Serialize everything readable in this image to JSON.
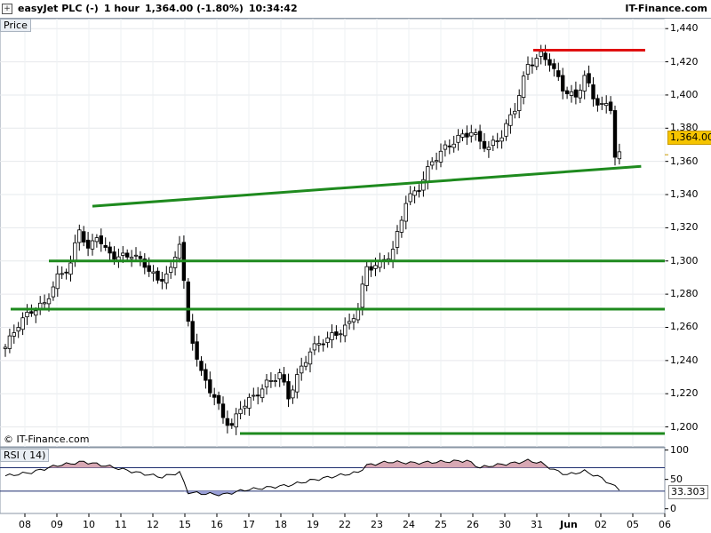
{
  "header": {
    "instrument": "easyJet PLC (-)",
    "timeframe": "1 hour",
    "last": "1,364.00 (-1.80%)",
    "time": "10:34:42",
    "brand": "IT-Finance.com"
  },
  "price_panel_label": "Price",
  "watermark": "© IT-Finance.com",
  "rsi_panel_label": "RSI ( 14)",
  "badges": {
    "price": "1,364.00",
    "rsi": "33.303"
  },
  "colors": {
    "support": "#1e8a1e",
    "resistance": "#e01010",
    "candle_up": "#ffffff",
    "candle_down": "#000000",
    "rsi_fill": "#d8a8b4",
    "price_badge": "#f5c400"
  },
  "chart_data": [
    {
      "type": "candlestick",
      "title": "easyJet PLC (-)",
      "xlabel": "",
      "ylabel": "Price",
      "ylim": [
        1188,
        1446
      ],
      "y_ticks": [
        "1,200",
        "1,220",
        "1,240",
        "1,260",
        "1,280",
        "1,300",
        "1,320",
        "1,340",
        "1,360",
        "1,380",
        "1,400",
        "1,420",
        "1,440"
      ],
      "y_tick_values": [
        1200,
        1220,
        1240,
        1260,
        1280,
        1300,
        1320,
        1340,
        1360,
        1380,
        1400,
        1420,
        1440
      ],
      "x_ticks": [
        "08",
        "09",
        "10",
        "11",
        "12",
        "15",
        "16",
        "17",
        "18",
        "19",
        "22",
        "23",
        "24",
        "25",
        "26",
        "30",
        "31",
        "Jun",
        "02",
        "05",
        "06"
      ],
      "grid": true,
      "close_path": [
        [
          0,
          1248
        ],
        [
          3,
          1262
        ],
        [
          6,
          1270
        ],
        [
          9,
          1274
        ],
        [
          12,
          1290
        ],
        [
          15,
          1298
        ],
        [
          17,
          1320
        ],
        [
          19,
          1306
        ],
        [
          21,
          1316
        ],
        [
          23,
          1306
        ],
        [
          26,
          1302
        ],
        [
          29,
          1304
        ],
        [
          32,
          1298
        ],
        [
          35,
          1288
        ],
        [
          38,
          1294
        ],
        [
          40,
          1312
        ],
        [
          42,
          1262
        ],
        [
          45,
          1232
        ],
        [
          48,
          1218
        ],
        [
          50,
          1206
        ],
        [
          52,
          1200
        ],
        [
          54,
          1212
        ],
        [
          57,
          1218
        ],
        [
          60,
          1226
        ],
        [
          63,
          1232
        ],
        [
          65,
          1218
        ],
        [
          67,
          1230
        ],
        [
          70,
          1246
        ],
        [
          73,
          1252
        ],
        [
          76,
          1256
        ],
        [
          79,
          1262
        ],
        [
          81,
          1272
        ],
        [
          83,
          1296
        ],
        [
          86,
          1298
        ],
        [
          89,
          1306
        ],
        [
          92,
          1336
        ],
        [
          95,
          1344
        ],
        [
          98,
          1360
        ],
        [
          101,
          1368
        ],
        [
          104,
          1374
        ],
        [
          107,
          1378
        ],
        [
          109,
          1372
        ],
        [
          111,
          1368
        ],
        [
          114,
          1376
        ],
        [
          117,
          1392
        ],
        [
          120,
          1418
        ],
        [
          123,
          1424
        ],
        [
          125,
          1420
        ],
        [
          128,
          1404
        ],
        [
          131,
          1398
        ],
        [
          133,
          1412
        ],
        [
          135,
          1398
        ],
        [
          137,
          1394
        ],
        [
          139,
          1392
        ],
        [
          140,
          1364
        ],
        [
          141,
          1364
        ]
      ],
      "last_close": 1364,
      "trend_lines": [
        {
          "type": "rising-support",
          "color": "#1e8a1e",
          "from": [
            20,
            1333
          ],
          "to": [
            146,
            1357
          ]
        },
        {
          "type": "horizontal-support",
          "color": "#1e8a1e",
          "y": 1300
        },
        {
          "type": "horizontal-support",
          "color": "#1e8a1e",
          "y": 1271
        },
        {
          "type": "horizontal-support",
          "color": "#1e8a1e",
          "y": 1196
        },
        {
          "type": "horizontal-resistance",
          "color": "#e01010",
          "y": 1427
        }
      ]
    },
    {
      "type": "line",
      "title": "RSI ( 14)",
      "ylim": [
        -8,
        104
      ],
      "y_ticks": [
        "100",
        "50",
        "0"
      ],
      "y_tick_values": [
        100,
        50,
        0
      ],
      "levels": [
        70,
        30
      ],
      "last_value": 33.303,
      "values_path": [
        [
          0,
          56
        ],
        [
          6,
          62
        ],
        [
          12,
          74
        ],
        [
          18,
          80
        ],
        [
          24,
          72
        ],
        [
          30,
          62
        ],
        [
          36,
          54
        ],
        [
          40,
          62
        ],
        [
          42,
          28
        ],
        [
          45,
          26
        ],
        [
          50,
          24
        ],
        [
          55,
          32
        ],
        [
          60,
          36
        ],
        [
          65,
          40
        ],
        [
          70,
          48
        ],
        [
          76,
          56
        ],
        [
          81,
          62
        ],
        [
          83,
          74
        ],
        [
          88,
          80
        ],
        [
          94,
          78
        ],
        [
          100,
          80
        ],
        [
          106,
          82
        ],
        [
          109,
          70
        ],
        [
          112,
          74
        ],
        [
          117,
          78
        ],
        [
          120,
          82
        ],
        [
          123,
          78
        ],
        [
          126,
          66
        ],
        [
          129,
          58
        ],
        [
          133,
          64
        ],
        [
          137,
          52
        ],
        [
          139,
          42
        ],
        [
          141,
          33.3
        ]
      ]
    }
  ]
}
